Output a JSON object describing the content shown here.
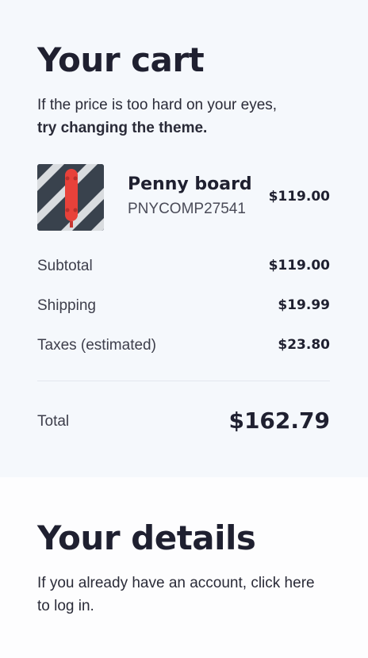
{
  "cart": {
    "title": "Your cart",
    "intro_text": "If the price is too hard on your eyes,",
    "intro_link": "try changing the theme.",
    "item": {
      "image_icon": "skateboard-image",
      "name": "Penny board",
      "sku": "PNYCOMP27541",
      "price": "$119.00"
    },
    "summary": {
      "subtotal_label": "Subtotal",
      "subtotal_value": "$119.00",
      "shipping_label": "Shipping",
      "shipping_value": "$19.99",
      "taxes_label": "Taxes (estimated)",
      "taxes_value": "$23.80",
      "total_label": "Total",
      "total_value": "$162.79"
    }
  },
  "details": {
    "title": "Your details",
    "intro_text": "If you already have an account, click here to log in."
  },
  "colors": {
    "cart_background": "#f5f8fc",
    "page_background": "#fdfdfe",
    "text": "#1f2030",
    "board_red": "#e8413a"
  }
}
